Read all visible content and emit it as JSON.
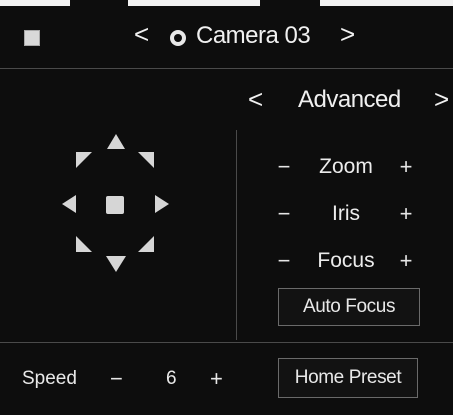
{
  "header": {
    "prev_symbol": "<",
    "next_symbol": ">",
    "camera_name": "Camera 03",
    "icons": {
      "left": "stop-square-icon",
      "camera": "camera-icon"
    }
  },
  "ptz": {
    "directions": [
      "up",
      "up-right",
      "right",
      "down-right",
      "down",
      "down-left",
      "left",
      "up-left"
    ],
    "center": "stop-icon"
  },
  "advanced": {
    "prev_symbol": "<",
    "title": "Advanced",
    "next_symbol": ">"
  },
  "controls": [
    {
      "label": "Zoom",
      "minus": "−",
      "plus": "+"
    },
    {
      "label": "Iris",
      "minus": "−",
      "plus": "+"
    },
    {
      "label": "Focus",
      "minus": "−",
      "plus": "+"
    }
  ],
  "auto_focus_label": "Auto Focus",
  "speed": {
    "label": "Speed",
    "minus": "−",
    "value": "6",
    "plus": "+"
  },
  "home_preset_label": "Home Preset",
  "colors": {
    "background": "#0d0d0d",
    "text": "#e8e8e8",
    "divider": "#4a4a4a",
    "button_border": "#6a6a6a"
  }
}
